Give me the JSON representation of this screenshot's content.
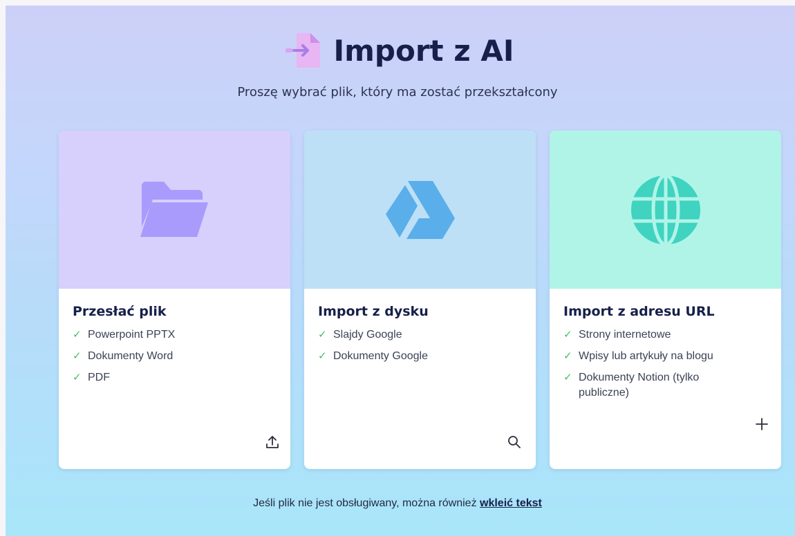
{
  "header": {
    "title": "Import z AI",
    "subtitle": "Proszę wybrać plik, który ma zostać przekształcony",
    "icon": "file-import-icon"
  },
  "cards": [
    {
      "title": "Przesłać plik",
      "icon": "folder-icon",
      "action_icon": "upload-icon",
      "top_color": "#d7cffc",
      "features": [
        "Powerpoint PPTX",
        "Dokumenty Word",
        "PDF"
      ]
    },
    {
      "title": "Import z dysku",
      "icon": "google-drive-icon",
      "action_icon": "search-icon",
      "top_color": "#bde0f7",
      "features": [
        "Slajdy Google",
        "Dokumenty Google"
      ]
    },
    {
      "title": "Import z adresu URL",
      "icon": "globe-icon",
      "action_icon": "plus-icon",
      "top_color": "#b0f4e8",
      "features": [
        "Strony internetowe",
        "Wpisy lub artykuły na blogu",
        "Dokumenty Notion (tylko publiczne)"
      ]
    }
  ],
  "footer": {
    "text": "Jeśli plik nie jest obsługiwany, można również",
    "link": "wkleić tekst"
  },
  "colors": {
    "check": "#3fbf6a",
    "title": "#16204a",
    "folder": "#a89bfb",
    "drive": "#5aaeea",
    "globe": "#3fd3c0"
  }
}
